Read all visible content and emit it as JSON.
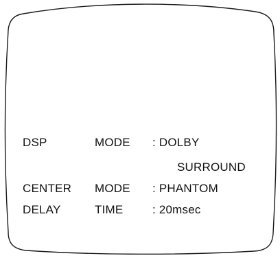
{
  "osd": {
    "rows": [
      {
        "label": "DSP",
        "sub": "MODE",
        "value": ": DOLBY",
        "value_cont": "SURROUND"
      },
      {
        "label": "CENTER",
        "sub": "MODE",
        "value": ": PHANTOM"
      },
      {
        "label": "DELAY",
        "sub": "TIME",
        "value": ": 20msec"
      }
    ]
  }
}
